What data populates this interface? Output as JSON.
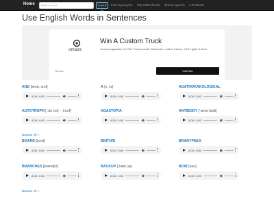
{
  "nav": {
    "home": "Home",
    "search_placeholder": "Enter a word",
    "search_button": "Look it up",
    "links": [
      "Find Synonyms",
      "Top 1000 Words",
      "Text to speech",
      "A-Z Words"
    ]
  },
  "page_title": "Use English Words in Sentences",
  "ad": {
    "brand_logo": "omaze",
    "headline": "Win A Custom Truck",
    "description": "Custom Upgrades On This Truck Include: Bluetooth, Leather Interior, LED Lights & More.",
    "brand_small": "Omaze",
    "cta": "Visit Site"
  },
  "player": {
    "time": "0:00 / 0:00"
  },
  "section1": {
    "words": [
      {
        "word": "AND",
        "ipa": "[ænd, ənd]"
      },
      {
        "word": "A",
        "ipa": "[ʌ, eɪ]"
      },
      {
        "word": "AGATHOKAKOLOGICAL",
        "ipa": ""
      },
      {
        "word": "AUTOTROPH",
        "ipa": "[ˈɔtəˌtrɒf, -ˌtroʊf]"
      },
      {
        "word": "AGASTOPIA",
        "ipa": ""
      },
      {
        "word": "ANTIBODY",
        "ipa": "[ˈæntɪˌbɒdi]"
      }
    ],
    "browse": "Browse All »"
  },
  "section2": {
    "words": [
      {
        "word": "BOARD",
        "ipa": "[bɔrd]"
      },
      {
        "word": "BINTURI",
        "ipa": ""
      },
      {
        "word": "BRADYPNEA",
        "ipa": ""
      },
      {
        "word": "BRANCHES",
        "ipa": "[bræntʃɪz]"
      },
      {
        "word": "BACKUP",
        "ipa": "[ˈbækˌʌp]"
      },
      {
        "word": "BOW",
        "ipa": "[baʊ]"
      }
    ],
    "browse": "Browse All »"
  }
}
